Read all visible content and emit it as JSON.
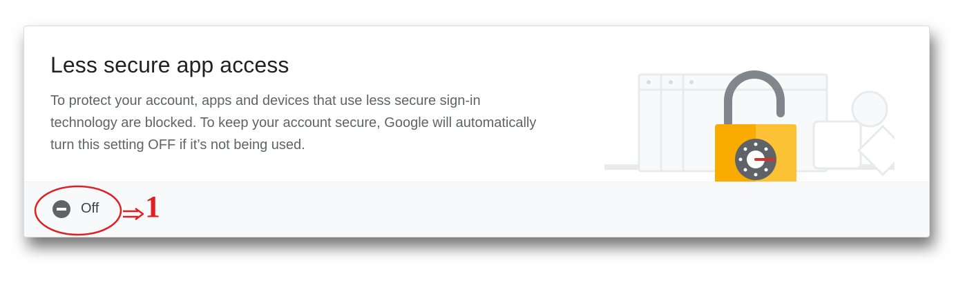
{
  "card": {
    "title": "Less secure app access",
    "description": "To protect your account, apps and devices that use less secure sign-in technology are blocked. To keep your account secure, Google will automatically turn this setting OFF if it’s not being used.",
    "illustration_icon": "padlock-unlocked-illustration"
  },
  "status": {
    "icon": "remove-circle-icon",
    "label": "Off"
  },
  "annotation": {
    "number": "1",
    "color": "#e02020"
  },
  "colors": {
    "lock_body": "#f9ab00",
    "lock_body_highlight": "#fdd663",
    "lock_shackle": "#80868b",
    "dial": "#5f6368",
    "dial_pointer": "#d93025",
    "status_icon": "#5f6368"
  }
}
